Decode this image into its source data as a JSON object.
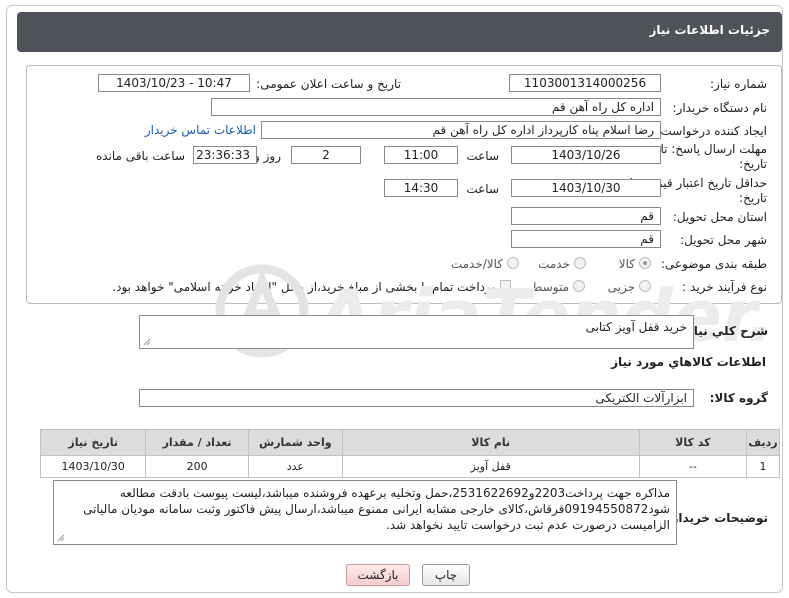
{
  "header": {
    "title": "جزئیات اطلاعات نیاز"
  },
  "form": {
    "need_number_label": "شماره نیاز:",
    "need_number": "1103001314000256",
    "announce_label": "تاریخ و ساعت اعلان عمومی:",
    "announce_value": "1403/10/23 - 10:47",
    "buyer_label": "نام دستگاه خریدار:",
    "buyer_value": "اداره کل  راه آهن قم",
    "creator_label": "ایجاد کننده درخواست:",
    "creator_value": "رضا اسلام پناه کارپرداز اداره کل  راه آهن قم",
    "contact_link": "اطلاعات تماس خریدار",
    "reply_deadline_label": "مهلت ارسال پاسخ: تا",
    "date_label": "تاریخ:",
    "reply_date": "1403/10/26",
    "time_label": "ساعت",
    "reply_time": "11:00",
    "days_value": "2",
    "days_label": "روز و",
    "remaining_time": "23:36:33",
    "remaining_label": "ساعت باقی مانده",
    "price_validity_label": "حداقل تاریخ اعتبار قیمت: تا",
    "validity_date": "1403/10/30",
    "validity_time": "14:30",
    "province_label": "استان محل تحویل:",
    "province_value": "قم",
    "city_label": "شهر محل تحویل:",
    "city_value": "قم",
    "category_label": "طبقه بندی موضوعی:",
    "category_options": [
      "کالا",
      "خدمت",
      "کالا/خدمت"
    ],
    "purchase_type_label": "نوع فرآیند خرید :",
    "purchase_options": [
      "جزیی",
      "متوسط"
    ],
    "payment_note": "پرداخت تمام یا بخشی از مبلغ خرید،از محل \"اسناد خزانه اسلامی\" خواهد بود."
  },
  "summary": {
    "label": "شرح کلي نياز:",
    "value": "خرید قفل آویز کتابی"
  },
  "goods": {
    "heading": "اطلاعات کالاهاي مورد نياز",
    "group_label": "گروه کالا:",
    "group_value": "ابزارآلات الکتریکی",
    "columns": [
      "ردیف",
      "کد کالا",
      "نام کالا",
      "واحد شمارش",
      "تعداد / مقدار",
      "تاریخ نیاز"
    ],
    "rows": [
      [
        "1",
        "--",
        "قفل آویز",
        "عدد",
        "200",
        "1403/10/30"
      ]
    ]
  },
  "buyer_notes": {
    "label": "توضیحات خریدار:",
    "lines": [
      "مذاکره جهت پرداخت2203و2531622692،حمل وتخلیه برعهده فروشنده میباشد،لیست پیوست بادقت مطالعه",
      "شود09194550872قرقاش،کالای خارجی مشابه ایرانی ممنوع میباشد،ارسال پیش فاکتور وثبت سامانه مودیان مالیاتی",
      "الزامیست درصورت عدم ثبت درخواست تایید نخواهد شد."
    ]
  },
  "buttons": {
    "print": "چاپ",
    "back": "بازگشت"
  }
}
